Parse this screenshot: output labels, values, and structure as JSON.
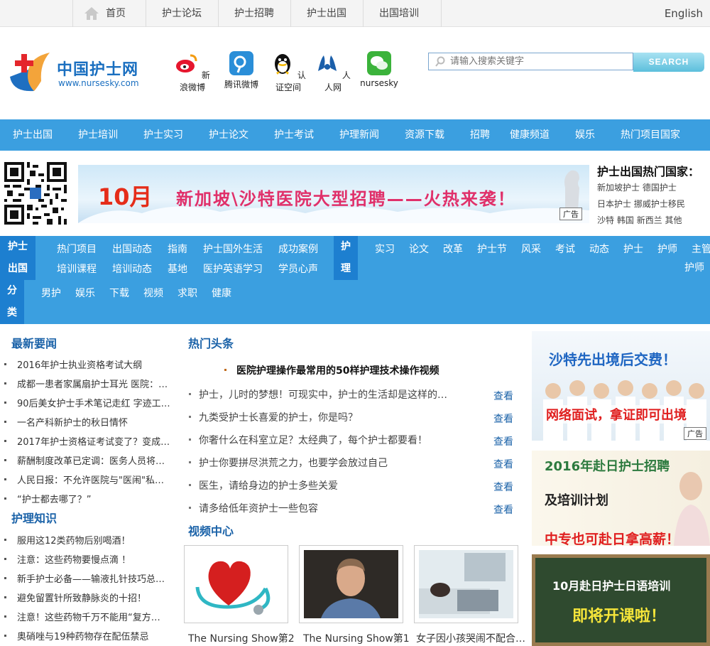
{
  "topbar": {
    "nav": [
      "首页",
      "护士论坛",
      "护士招聘",
      "护士出国",
      "出国培训"
    ],
    "lang": "English"
  },
  "logo": {
    "name": "中国护士网",
    "url": "www.nursesky.com"
  },
  "social": [
    {
      "label": "新浪微博",
      "icon": "sina-weibo-icon",
      "color": "#e6162d"
    },
    {
      "label": "腾讯微博",
      "icon": "tencent-weibo-icon",
      "color": "#2a8ed8"
    },
    {
      "label": "认证空间",
      "icon": "qq-penguin-icon",
      "color": "#111111"
    },
    {
      "label": "人人网",
      "icon": "renren-icon",
      "color": "#1b5faa"
    },
    {
      "label": "nursesky",
      "icon": "wechat-icon",
      "color": "#3bb33b"
    }
  ],
  "search": {
    "placeholder": "请输入搜索关键字",
    "button": "SEARCH"
  },
  "mainnav": [
    "护士出国",
    "护士培训",
    "护士实习",
    "护士论文",
    "护士考试",
    "护理新闻",
    "资源下载",
    "招聘",
    "健康频道",
    "娱乐",
    "热门项目国家"
  ],
  "banner": {
    "month": "10月",
    "text": "新加坡\\沙特医院大型招聘——火热来袭！",
    "ad": "广告"
  },
  "hot": {
    "title": "护士出国热门国家：",
    "rows": [
      [
        "新加坡护士",
        "德国护士"
      ],
      [
        "日本护士",
        "挪威护士移民"
      ],
      [
        "沙特",
        "韩国",
        "新西兰",
        "其他"
      ]
    ]
  },
  "categories": {
    "label1": [
      "护士",
      "出国",
      "分",
      "类"
    ],
    "row1": [
      "热门项目",
      "出国动态",
      "指南",
      "护士国外生活",
      "成功案例"
    ],
    "row2": [
      "培训课程",
      "培训动态",
      "基地",
      "医护英语学习",
      "学员心声"
    ],
    "row3": [
      "男护",
      "娱乐",
      "下载",
      "视频",
      "求职",
      "健康"
    ],
    "label2": [
      "护",
      "理"
    ],
    "row4": [
      "实习",
      "论文",
      "改革",
      "护士节",
      "风采",
      "考试",
      "动态",
      "护士",
      "护师",
      "主管"
    ],
    "row5": [
      "护师"
    ]
  },
  "news": {
    "title": "最新要闻",
    "items": [
      "2016年护士执业资格考试大纲",
      "成都一患者家属扇护士耳光 医院：…",
      "90后美女护士手术笔记走红 字迹工…",
      "一名产科新护士的秋日情怀",
      "2017年护士资格证考试变了？变成…",
      "薪酬制度改革已定调：医务人员将…",
      "人民日报：不允许医院与\"医闹\"私…",
      "“护士都去哪了？”"
    ]
  },
  "knowledge": {
    "title": "护理知识",
    "items": [
      "服用这12类药物后别喝酒！",
      "注意：这些药物要慢点滴 ！",
      "新手护士必备——输液扎针技巧总…",
      "避免留置针所致静脉炎的十招！",
      "注意！这些药物千万不能用“复方…",
      "奥硝唑与19种药物存在配伍禁忌"
    ]
  },
  "headlines": {
    "title": "热门头条",
    "featured": "医院护理操作最常用的50样护理技术操作视频",
    "items": [
      "护士，儿时的梦想！可现实中，护士的生活却是这样的…",
      "九类受护士长喜爱的护士，你是吗？",
      "你奢什么在科室立足？太经典了，每个护士都要看！",
      "护士你要拼尽洪荒之力，也要学会放过自己",
      "医生，请给身边的护士多些关爱",
      "请多给低年资护士一些包容"
    ],
    "view": "查看"
  },
  "video": {
    "title": "视频中心",
    "items": [
      "The Nursing Show第2",
      "The Nursing Show第1",
      "女子因小孩哭闹不配合…"
    ]
  },
  "ads": {
    "a1": {
      "top": "沙特先出境后交费！",
      "bottom": "网络面试，拿证即可出境",
      "tag": "广告"
    },
    "a2": {
      "line1": "2016年赴日护士招聘",
      "line2": "及培训计划",
      "line3": "中专也可赴日拿高薪！"
    },
    "a3": {
      "line1": "10月赴日护士日语培训",
      "line2": "即将开课啦！"
    }
  }
}
